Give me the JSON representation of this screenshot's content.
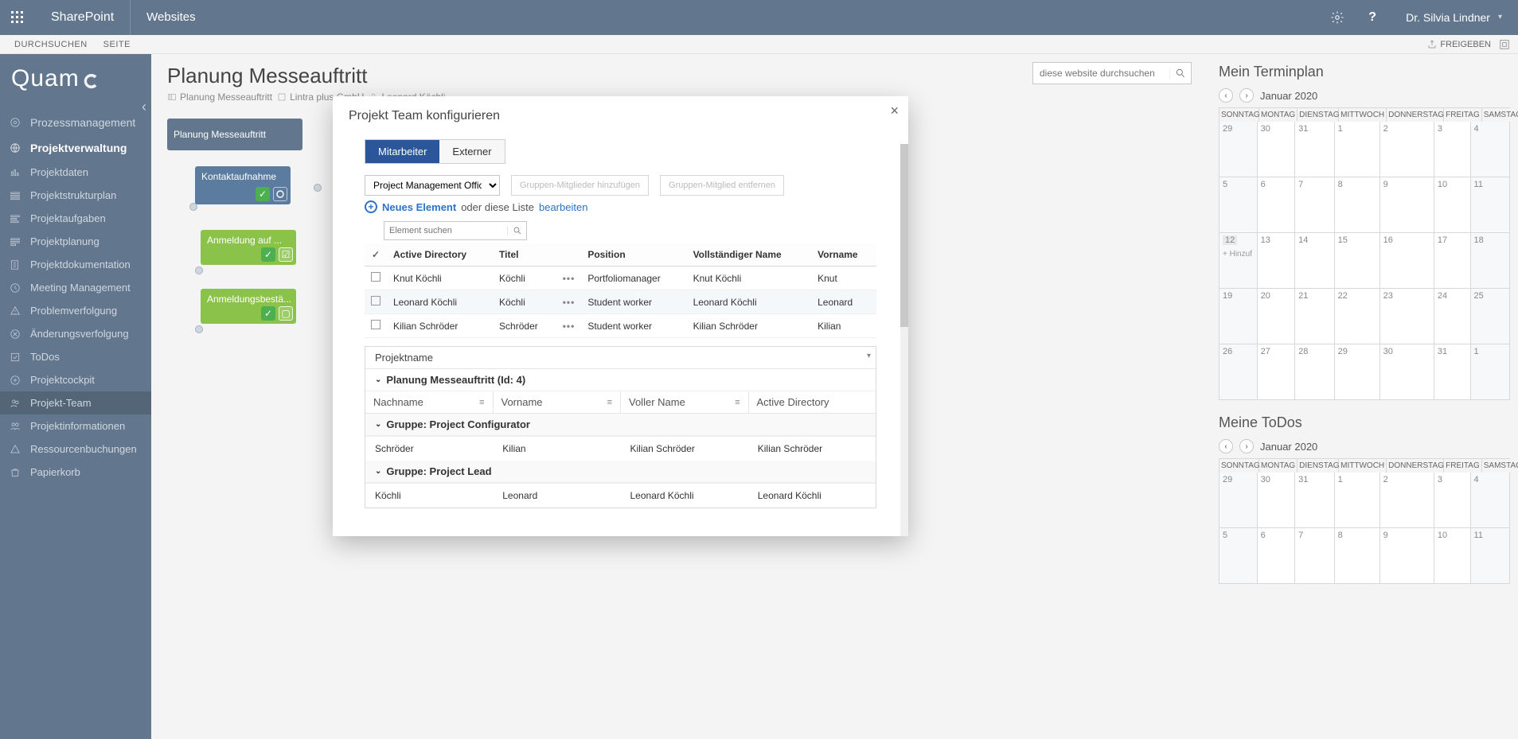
{
  "suite": {
    "brand": "SharePoint",
    "link": "Websites",
    "user": "Dr. Silvia Lindner"
  },
  "ribbon": {
    "tabs": [
      "DURCHSUCHEN",
      "SEITE"
    ],
    "share": "FREIGEBEN"
  },
  "sidebar": {
    "logo": "Quam",
    "top": [
      {
        "label": "Prozessmanagement"
      },
      {
        "label": "Projektverwaltung",
        "active": true
      }
    ],
    "items": [
      {
        "label": "Projektdaten"
      },
      {
        "label": "Projektstrukturplan"
      },
      {
        "label": "Projektaufgaben"
      },
      {
        "label": "Projektplanung"
      },
      {
        "label": "Projektdokumentation"
      },
      {
        "label": "Meeting Management"
      },
      {
        "label": "Problemverfolgung"
      },
      {
        "label": "Änderungsverfolgung"
      },
      {
        "label": "ToDos"
      },
      {
        "label": "Projektcockpit"
      },
      {
        "label": "Projekt-Team",
        "selected": true
      },
      {
        "label": "Projektinformationen"
      },
      {
        "label": "Ressourcenbuchungen"
      },
      {
        "label": "Papierkorb"
      }
    ]
  },
  "page": {
    "title": "Planung Messeauftritt",
    "crumbs": [
      "Planung Messeauftritt",
      "Lintra plus GmbH",
      "Leonard Köchli"
    ],
    "search_placeholder": "diese website durchsuchen"
  },
  "diagram": {
    "root": "Planung Messeauftritt",
    "activity": "Kontaktaufnahme",
    "green1": "Anmeldung auf ...",
    "green2": "Anmeldungsbestä..."
  },
  "rail": {
    "title1": "Mein Terminplan",
    "title2": "Meine ToDos",
    "month": "Januar 2020",
    "day_heads": [
      "SONNTAG",
      "MONTAG",
      "DIENSTAG",
      "MITTWOCH",
      "DONNERSTAG",
      "FREITAG",
      "SAMSTAG"
    ],
    "weeks": [
      [
        "29",
        "30",
        "31",
        "1",
        "2",
        "3",
        "4"
      ],
      [
        "5",
        "6",
        "7",
        "8",
        "9",
        "10",
        "11"
      ],
      [
        "12",
        "13",
        "14",
        "15",
        "16",
        "17",
        "18"
      ],
      [
        "19",
        "20",
        "21",
        "22",
        "23",
        "24",
        "25"
      ],
      [
        "26",
        "27",
        "28",
        "29",
        "30",
        "31",
        "1"
      ]
    ],
    "today": "12",
    "add_hint": "+ Hinzuf",
    "weeks2": [
      [
        "29",
        "30",
        "31",
        "1",
        "2",
        "3",
        "4"
      ],
      [
        "5",
        "6",
        "7",
        "8",
        "9",
        "10",
        "11"
      ]
    ]
  },
  "modal": {
    "title": "Projekt Team konfigurieren",
    "tabs": [
      "Mitarbeiter",
      "Externer"
    ],
    "group_select": "Project Management Office",
    "btn_add": "Gruppen-Mitglieder hinzufügen",
    "btn_remove": "Gruppen-Mitglied entfernen",
    "new_el": "Neues Element",
    "or": "oder diese Liste",
    "edit": "bearbeiten",
    "search_ph": "Element suchen",
    "cols": [
      "Active Directory",
      "Titel",
      "",
      "Position",
      "Vollständiger Name",
      "Vorname"
    ],
    "rows": [
      {
        "ad": "Knut Köchli",
        "titel": "Köchli",
        "pos": "Portfoliomanager",
        "full": "Knut Köchli",
        "vor": "Knut"
      },
      {
        "ad": "Leonard Köchli",
        "titel": "Köchli",
        "pos": "Student worker",
        "full": "Leonard Köchli",
        "vor": "Leonard",
        "alt": true
      },
      {
        "ad": "Kilian Schröder",
        "titel": "Schröder",
        "pos": "Student worker",
        "full": "Kilian Schröder",
        "vor": "Kilian"
      }
    ],
    "panel_title": "Projektname",
    "group_label": "Planung Messeauftritt (Id: 4)",
    "subcols": [
      "Nachname",
      "Vorname",
      "Voller Name",
      "Active Directory"
    ],
    "group1": "Gruppe: Project Configurator",
    "row1": {
      "n": "Schröder",
      "v": "Kilian",
      "full": "Kilian Schröder",
      "ad": "Kilian Schröder"
    },
    "group2": "Gruppe: Project Lead",
    "row2": {
      "n": "Köchli",
      "v": "Leonard",
      "full": "Leonard Köchli",
      "ad": "Leonard Köchli"
    }
  }
}
